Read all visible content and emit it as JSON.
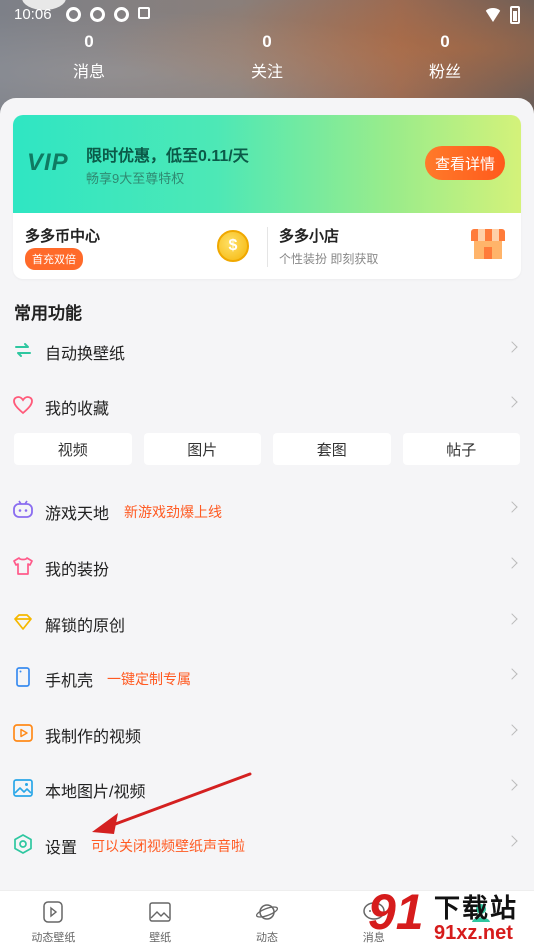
{
  "status": {
    "time": "10:06"
  },
  "stats": [
    {
      "num": "0",
      "label": "消息"
    },
    {
      "num": "0",
      "label": "关注"
    },
    {
      "num": "0",
      "label": "粉丝"
    }
  ],
  "vip": {
    "logo": "VIP",
    "title": "限时优惠，低至0.11/天",
    "subtitle": "畅享9大至尊特权",
    "button": "查看详情"
  },
  "coin": {
    "title": "多多币中心",
    "badge": "首充双倍",
    "icon_glyph": "$"
  },
  "shop": {
    "title": "多多小店",
    "subtitle": "个性装扮 即刻获取"
  },
  "section_title": "常用功能",
  "menu": {
    "auto_wallpaper": {
      "label": "自动换壁纸"
    },
    "favorites": {
      "label": "我的收藏"
    },
    "games": {
      "label": "游戏天地",
      "tag": "新游戏劲爆上线"
    },
    "dressup": {
      "label": "我的装扮"
    },
    "unlocked": {
      "label": "解锁的原创"
    },
    "phone_case": {
      "label": "手机壳",
      "tag": "一键定制专属"
    },
    "my_videos": {
      "label": "我制作的视频"
    },
    "local_media": {
      "label": "本地图片/视频"
    },
    "settings": {
      "label": "设置",
      "tag": "可以关闭视频壁纸声音啦"
    }
  },
  "chips": [
    "视频",
    "图片",
    "套图",
    "帖子"
  ],
  "nav": [
    {
      "label": "动态壁纸",
      "icon": "play-video-icon"
    },
    {
      "label": "壁纸",
      "icon": "image-icon"
    },
    {
      "label": "动态",
      "icon": "planet-icon"
    },
    {
      "label": "消息",
      "icon": "chat-icon"
    },
    {
      "label": "",
      "icon": "profile-icon"
    }
  ],
  "watermark": {
    "big": "91",
    "text1": "下载站",
    "text2": "91xz.net"
  },
  "colors": {
    "accent": "#ff5a22",
    "vip_start": "#2fe6c3",
    "vip_end": "#d4f27a",
    "arrow": "#d42020"
  }
}
